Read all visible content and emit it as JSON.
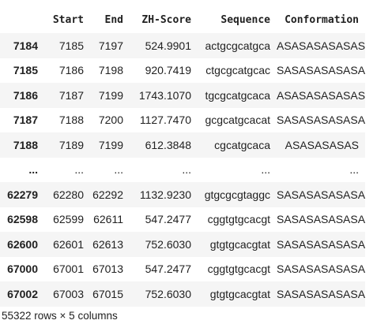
{
  "table": {
    "columns": [
      "",
      "Start",
      "End",
      "ZH-Score",
      "Sequence",
      "Conformation"
    ],
    "rows": [
      {
        "index": "7184",
        "cells": [
          "7185",
          "7197",
          "524.9901",
          "actgcgcatgca",
          "ASASASASASAS"
        ]
      },
      {
        "index": "7185",
        "cells": [
          "7186",
          "7198",
          "920.7419",
          "ctgcgcatgcac",
          "SASASASASASA"
        ]
      },
      {
        "index": "7186",
        "cells": [
          "7187",
          "7199",
          "1743.1070",
          "tgcgcatgcaca",
          "ASASASASASAS"
        ]
      },
      {
        "index": "7187",
        "cells": [
          "7188",
          "7200",
          "1127.7470",
          "gcgcatgcacat",
          "SASASASASASA"
        ]
      },
      {
        "index": "7188",
        "cells": [
          "7189",
          "7199",
          "612.3848",
          "cgcatgcaca",
          "ASASASASAS"
        ]
      },
      {
        "index": "...",
        "cells": [
          "...",
          "...",
          "...",
          "...",
          "..."
        ]
      },
      {
        "index": "62279",
        "cells": [
          "62280",
          "62292",
          "1132.9230",
          "gtgcgcgtaggc",
          "SASASASASASA"
        ]
      },
      {
        "index": "62598",
        "cells": [
          "62599",
          "62611",
          "547.2477",
          "cggtgtgcacgt",
          "SASASASASASA"
        ]
      },
      {
        "index": "62600",
        "cells": [
          "62601",
          "62613",
          "752.6030",
          "gtgtgcacgtat",
          "SASASASASASA"
        ]
      },
      {
        "index": "67000",
        "cells": [
          "67001",
          "67013",
          "547.2477",
          "cggtgtgcacgt",
          "SASASASASASA"
        ]
      },
      {
        "index": "67002",
        "cells": [
          "67003",
          "67015",
          "752.6030",
          "gtgtgcacgtat",
          "SASASASASASA"
        ]
      }
    ]
  },
  "footer": {
    "summary": "55322 rows × 5 columns"
  }
}
